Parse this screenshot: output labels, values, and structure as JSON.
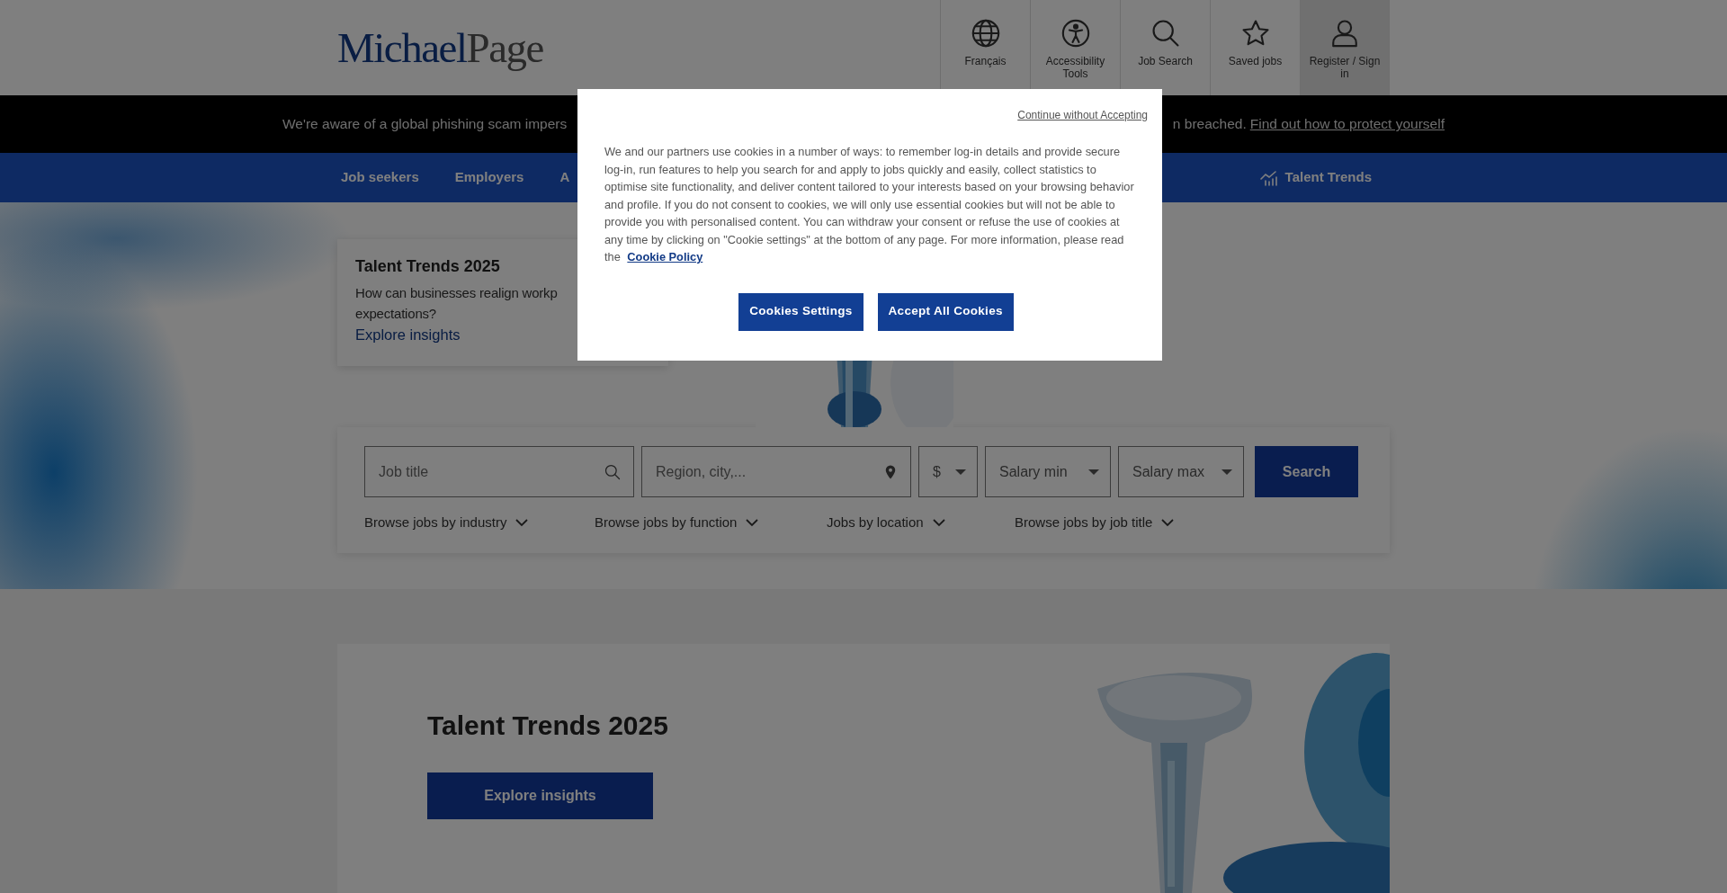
{
  "header": {
    "logo": {
      "first": "Michael",
      "second": "Page"
    },
    "actions": [
      {
        "label": "Français",
        "selected": false
      },
      {
        "label": "Accessibility Tools",
        "selected": false
      },
      {
        "label": "Job Search",
        "selected": false
      },
      {
        "label": "Saved jobs",
        "selected": false
      },
      {
        "label": "Register / Sign in",
        "selected": true
      }
    ]
  },
  "alert": {
    "text_start": "We're aware of a global phishing scam impers",
    "text_end": "n breached.",
    "link": "Find out how to protect yourself"
  },
  "nav": {
    "items": [
      "Job seekers",
      "Employers",
      "A"
    ],
    "right": "Talent Trends"
  },
  "hero_card": {
    "title": "Talent Trends 2025",
    "text": "How can businesses realign workp\nexpectations?",
    "link": "Explore insights"
  },
  "search": {
    "fields": [
      {
        "placeholder": "Job title",
        "kind": "search"
      },
      {
        "placeholder": "Region, city,...",
        "kind": "location"
      }
    ],
    "selects": [
      {
        "value": "$"
      },
      {
        "value": "Salary min"
      },
      {
        "value": "Salary max"
      }
    ],
    "button": "Search",
    "browse": [
      "Browse jobs by industry",
      "Browse jobs by function",
      "Jobs by location",
      "Browse jobs by job title"
    ]
  },
  "promo": {
    "title": "Talent Trends 2025",
    "button": "Explore insights"
  },
  "cookie_dialog": {
    "dismiss": "Continue without Accepting",
    "text": "We and our partners use cookies in a number of ways: to remember log-in details and provide secure log-in, run features to help you search for and apply to jobs quickly and easily, collect statistics to optimise site functionality, and deliver content tailored to your interests based on your browsing behavior and profile. If you do not consent to cookies, we will only use essential cookies but will not be able to provide you with personalised content. You can withdraw your consent or refuse the use of cookies at any time by clicking on \"Cookie settings\" at the bottom of any page. For more information, please read the ",
    "link": "Cookie Policy",
    "buttons": [
      "Cookies Settings",
      "Accept All Cookies"
    ]
  }
}
